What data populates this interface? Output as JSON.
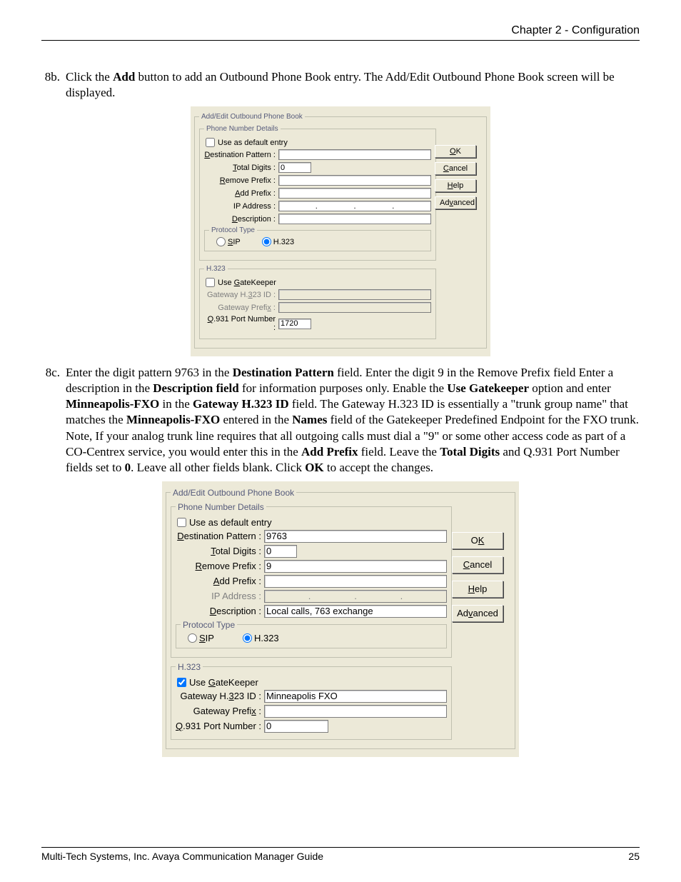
{
  "header": {
    "chapter": "Chapter 2 - Configuration"
  },
  "step_8b": {
    "num": "8b.",
    "text_before_add": "Click the ",
    "bold_add": "Add",
    "text_after_add": " button to add an Outbound Phone Book entry. The Add/Edit Outbound Phone Book screen will be displayed."
  },
  "step_8c": {
    "num": "8c.",
    "pieces": [
      {
        "t": "Enter the digit pattern 9763 in the "
      },
      {
        "b": "Destination Pattern"
      },
      {
        "t": " field. Enter the digit 9 in the Remove Prefix field Enter a description in the "
      },
      {
        "b": "Description field"
      },
      {
        "t": " for information purposes only. Enable the "
      },
      {
        "b": "Use Gatekeeper"
      },
      {
        "t": " option and enter "
      },
      {
        "b": "Minneapolis-FXO"
      },
      {
        "t": " in the "
      },
      {
        "b": "Gateway H.323 ID"
      },
      {
        "t": " field.  The Gateway H.323 ID is essentially a \"trunk group name\" that matches the "
      },
      {
        "b": "Minneapolis-FXO"
      },
      {
        "t": " entered in the "
      },
      {
        "b": "Names"
      },
      {
        "t": " field of the Gatekeeper Predefined Endpoint for the FXO trunk. Note, If your analog trunk line requires that all outgoing calls must dial a \"9\" or some other access code as part of a CO-Centrex service, you would enter this in the "
      },
      {
        "b": "Add Prefix"
      },
      {
        "t": " field. Leave the "
      },
      {
        "b": "Total Digits"
      },
      {
        "t": " and Q.931 Port Number fields set to "
      },
      {
        "b": "0"
      },
      {
        "t": ". Leave all other fields blank. Click "
      },
      {
        "b": "OK"
      },
      {
        "t": " to accept the changes."
      }
    ]
  },
  "dialog_shared": {
    "group_title": "Add/Edit Outbound Phone Book",
    "phone_group": "Phone Number Details",
    "use_default": "Use as default entry",
    "dest_pattern": "Destination Pattern :",
    "total_digits": "Total Digits :",
    "remove_prefix": "Remove Prefix :",
    "add_prefix": "Add Prefix :",
    "ip_address": "IP Address :",
    "description": "Description :",
    "protocol_group": "Protocol Type",
    "sip": "SIP",
    "h323": "H.323",
    "h323_group": "H.323",
    "use_gatekeeper": "Use GateKeeper",
    "gw_h323_id": "Gateway H.323 ID :",
    "gw_prefix": "Gateway Prefix :",
    "q931": "Q.931 Port Number :",
    "btn_ok": "OK",
    "btn_cancel": "Cancel",
    "btn_help": "Help",
    "btn_advanced": "Advanced"
  },
  "dialog1_values": {
    "dest_pattern": "",
    "total_digits": "0",
    "remove_prefix": "",
    "add_prefix": "",
    "description": "",
    "use_gatekeeper": false,
    "gw_h323_id": "",
    "gw_prefix": "",
    "q931": "1720",
    "sip_selected": false,
    "h323_selected": true
  },
  "dialog2_values": {
    "dest_pattern": "9763",
    "total_digits": "0",
    "remove_prefix": "9",
    "add_prefix": "",
    "description": "Local calls, 763 exchange",
    "use_gatekeeper": true,
    "gw_h323_id": "Minneapolis FXO",
    "gw_prefix": "",
    "q931": "0",
    "sip_selected": false,
    "h323_selected": true
  },
  "footer": {
    "left": "Multi-Tech Systems, Inc. Avaya Communication Manager Guide",
    "right": "25"
  }
}
